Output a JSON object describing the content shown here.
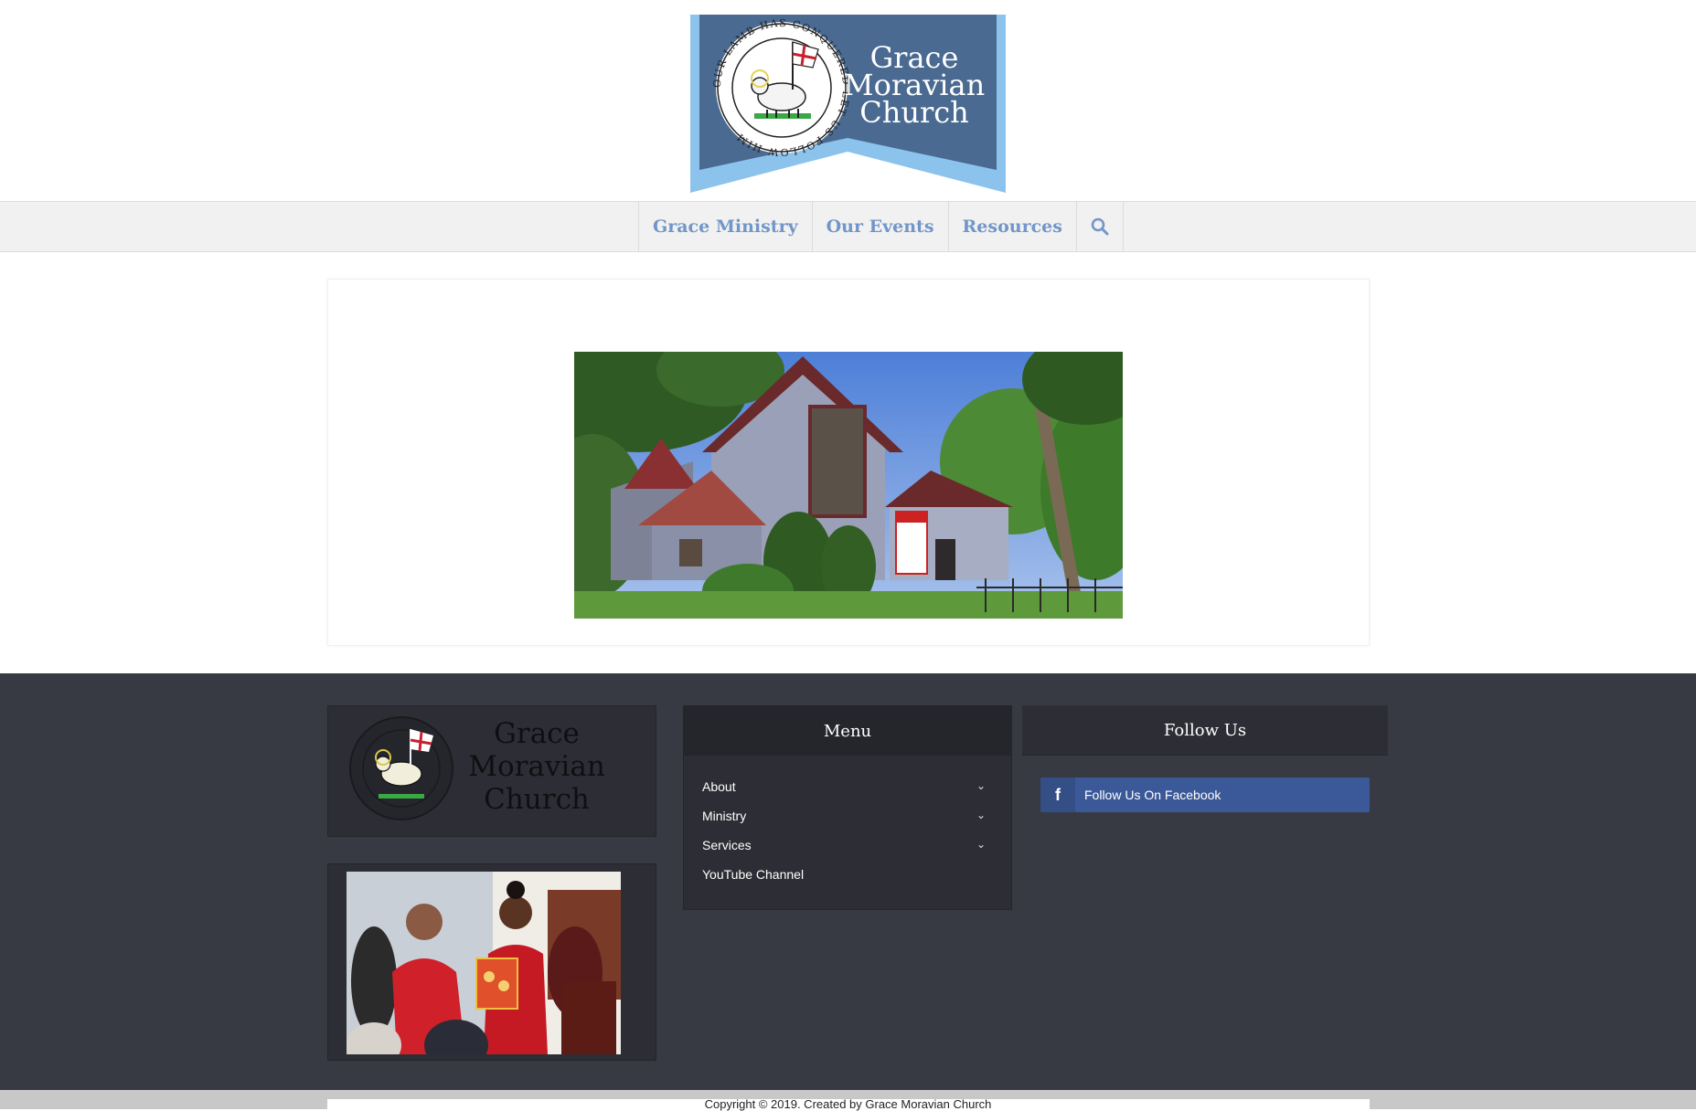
{
  "site": {
    "logo_line1": "Grace",
    "logo_line2": "Moravian",
    "logo_line3": "Church",
    "seal_text": "OUR LAMB HAS CONQUERED LET US FOLLOW HIM"
  },
  "nav": {
    "items": [
      {
        "label": "Grace Ministry"
      },
      {
        "label": "Our Events"
      },
      {
        "label": "Resources"
      }
    ],
    "search_icon": "search-icon"
  },
  "footer": {
    "logo_line1": "Grace",
    "logo_line2": "Moravian",
    "logo_line3": "Church",
    "menu_title": "Menu",
    "menu_items": [
      {
        "label": "About",
        "has_submenu": true
      },
      {
        "label": "Ministry",
        "has_submenu": true
      },
      {
        "label": "Services",
        "has_submenu": true
      },
      {
        "label": "YouTube Channel",
        "has_submenu": false
      }
    ],
    "follow_title": "Follow Us",
    "facebook_label": "Follow Us On Facebook",
    "facebook_icon": "f"
  },
  "copyright": "Copyright © 2019. Created by Grace Moravian Church",
  "colors": {
    "nav_text": "#7196c8",
    "footer_bg": "#383a43",
    "facebook": "#3b5998",
    "logo_blue": "#4a6a91"
  }
}
